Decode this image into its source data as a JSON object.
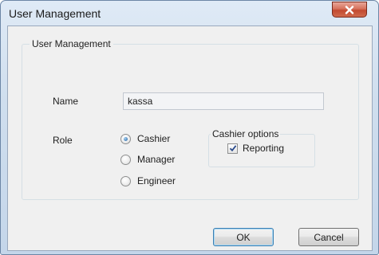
{
  "window": {
    "title": "User Management",
    "close_icon": "close-icon"
  },
  "group": {
    "title": "User Management"
  },
  "name": {
    "label": "Name",
    "value": "kassa"
  },
  "role": {
    "label": "Role",
    "options": [
      {
        "label": "Cashier",
        "selected": true
      },
      {
        "label": "Manager",
        "selected": false
      },
      {
        "label": "Engineer",
        "selected": false
      }
    ]
  },
  "cashier_options": {
    "title": "Cashier options",
    "reporting_label": "Reporting",
    "reporting_checked": true
  },
  "buttons": {
    "ok_label": "OK",
    "cancel_label": "Cancel"
  },
  "colors": {
    "close_button": "#c24a30",
    "dialog_background": "#f0f0f0"
  }
}
